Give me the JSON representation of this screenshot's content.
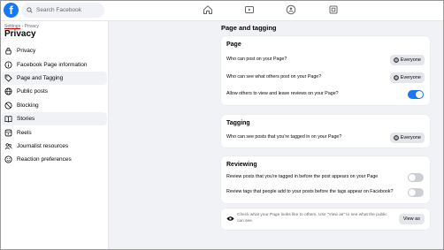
{
  "topbar": {
    "logo_letter": "f",
    "search_placeholder": "Search Facebook"
  },
  "sidebar": {
    "breadcrumb_settings": "Settings",
    "breadcrumb_sep": " › ",
    "breadcrumb_current": "Privacy",
    "title": "Privacy",
    "items": [
      {
        "label": "Privacy",
        "icon": "lock-icon"
      },
      {
        "label": "Facebook Page information",
        "icon": "info-icon"
      },
      {
        "label": "Page and Tagging",
        "icon": "tag-icon"
      },
      {
        "label": "Public posts",
        "icon": "globe-icon"
      },
      {
        "label": "Blocking",
        "icon": "block-icon"
      },
      {
        "label": "Stories",
        "icon": "book-icon"
      },
      {
        "label": "Reels",
        "icon": "reels-icon"
      },
      {
        "label": "Journalist resources",
        "icon": "people-icon"
      },
      {
        "label": "Reaction preferences",
        "icon": "reaction-icon"
      }
    ]
  },
  "main": {
    "title": "Page and tagging",
    "page_card": {
      "title": "Page",
      "rows": [
        {
          "label": "Who can post on your Page?",
          "value": "Everyone"
        },
        {
          "label": "Who can see what others post on your Page?",
          "value": "Everyone"
        },
        {
          "label": "Allow others to view and leave reviews on your Page?",
          "toggle": true
        }
      ]
    },
    "tagging_card": {
      "title": "Tagging",
      "rows": [
        {
          "label": "Who can see posts that you're tagged in on your Page?",
          "value": "Everyone"
        }
      ]
    },
    "reviewing_card": {
      "title": "Reviewing",
      "rows": [
        {
          "label": "Review posts that you're tagged in before the post appears on your Page",
          "toggle": false
        },
        {
          "label": "Review tags that people add to your posts before the tags appear on Facebook?",
          "toggle": false
        }
      ]
    },
    "info": {
      "text": "Check what your Page looks like to others. Use \"View as\" to see what the public can see.",
      "button": "View as"
    }
  },
  "colors": {
    "accent": "#1877f2",
    "background": "#f0f2f5",
    "toggle_off": "#ccd0d5"
  }
}
